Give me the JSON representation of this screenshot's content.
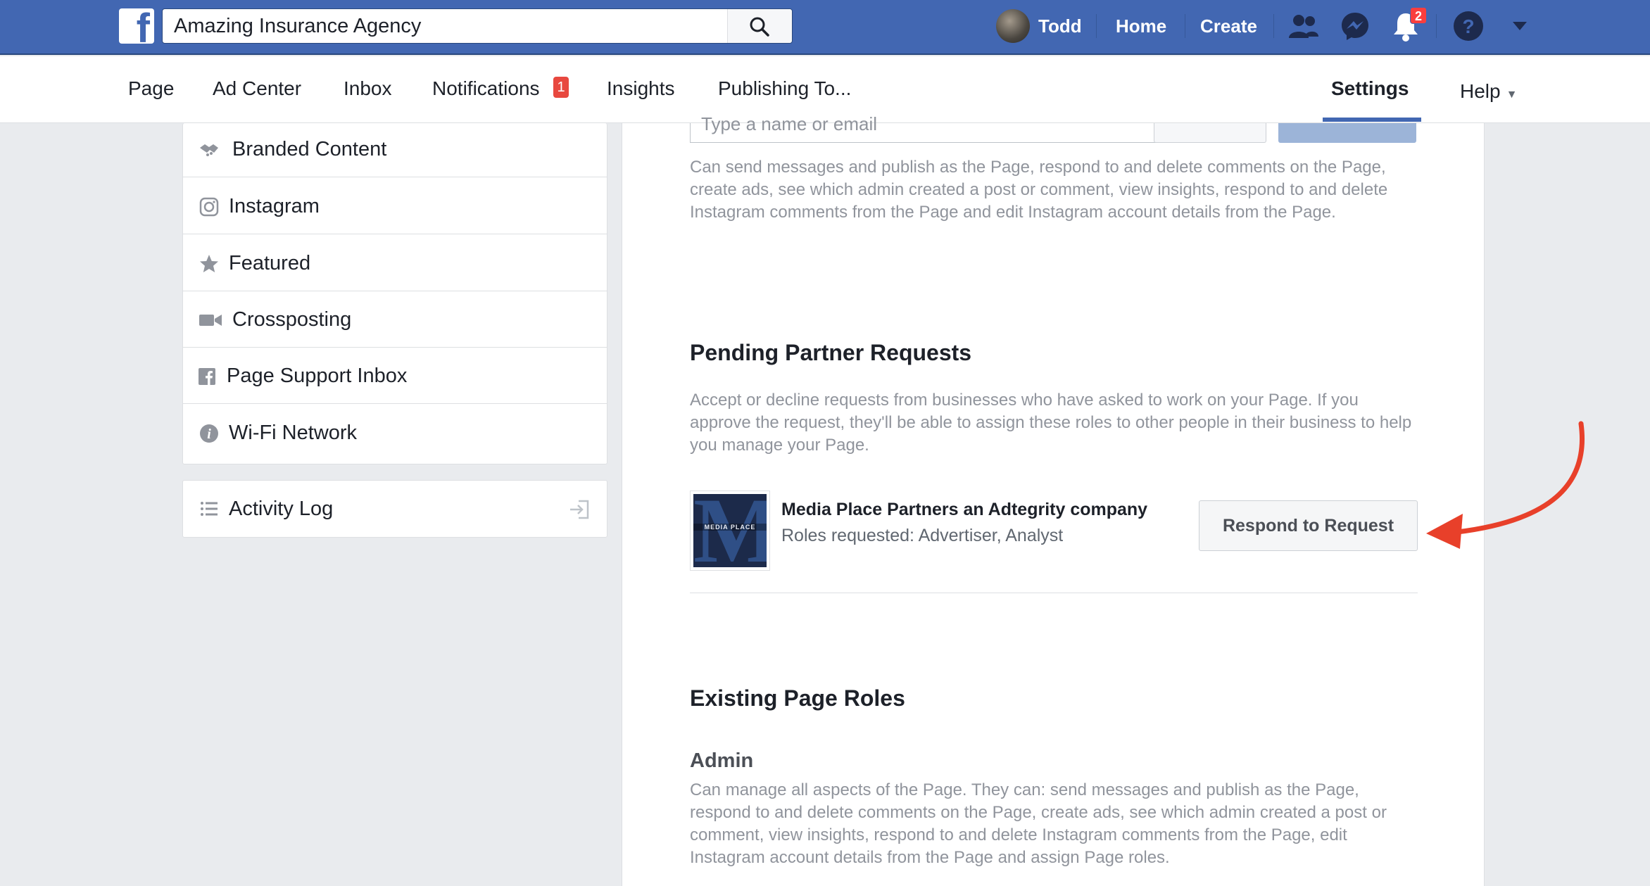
{
  "topbar": {
    "search_value": "Amazing Insurance Agency",
    "user_name": "Todd",
    "home_label": "Home",
    "create_label": "Create",
    "notifications_count": "2"
  },
  "page_nav": {
    "tabs": [
      {
        "label": "Page"
      },
      {
        "label": "Ad Center"
      },
      {
        "label": "Inbox"
      },
      {
        "label": "Notifications",
        "badge": "1"
      },
      {
        "label": "Insights"
      },
      {
        "label": "Publishing To..."
      },
      {
        "label": "Settings"
      },
      {
        "label": "Help"
      }
    ]
  },
  "sidebar": {
    "items": [
      {
        "label": "Branded Content",
        "icon": "handshake-icon"
      },
      {
        "label": "Instagram",
        "icon": "instagram-icon"
      },
      {
        "label": "Featured",
        "icon": "star-icon"
      },
      {
        "label": "Crossposting",
        "icon": "video-camera-icon"
      },
      {
        "label": "Page Support Inbox",
        "icon": "facebook-square-icon"
      },
      {
        "label": "Wi-Fi Network",
        "icon": "info-icon"
      }
    ],
    "activity_log": {
      "label": "Activity Log",
      "icon": "list-icon"
    }
  },
  "main": {
    "assign_placeholder": "Type a name or email",
    "editor_description": "Can send messages and publish as the Page, respond to and delete comments on the Page, create ads, see which admin created a post or comment, view insights, respond to and delete Instagram comments from the Page and edit Instagram account details from the Page.",
    "pending_title": "Pending Partner Requests",
    "pending_description": "Accept or decline requests from businesses who have asked to work on your Page. If you approve the request, they'll be able to assign these roles to other people in their business to help you manage your Page.",
    "partner": {
      "name": "Media Place Partners an Adtegrity company",
      "roles": "Roles requested: Advertiser, Analyst",
      "logo_text": "MEDIA PLACE",
      "respond_label": "Respond to Request"
    },
    "existing_title": "Existing Page Roles",
    "admin_title": "Admin",
    "admin_description": "Can manage all aspects of the Page. They can: send messages and publish as the Page, respond to and delete comments on the Page, create ads, see which admin created a post or comment, view insights, respond to and delete Instagram comments from the Page, edit Instagram account details from the Page and assign Page roles."
  },
  "colors": {
    "brand_blue": "#4267b2",
    "annotation_arrow": "#e8402a",
    "badge_red": "#fa3e3e"
  }
}
